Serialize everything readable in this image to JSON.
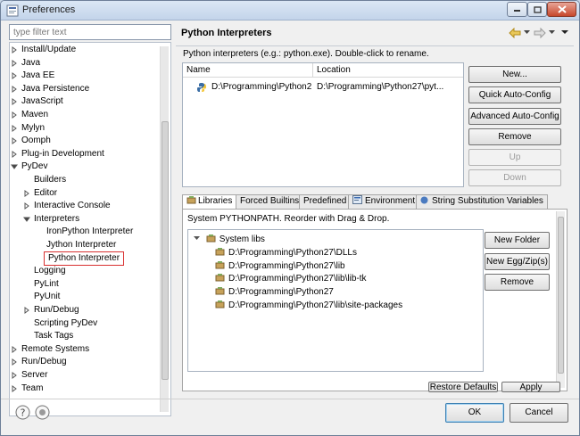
{
  "window": {
    "title": "Preferences"
  },
  "filter": {
    "placeholder": "type filter text"
  },
  "tree": [
    {
      "label": "Install/Update",
      "level": 0,
      "arrow": "right"
    },
    {
      "label": "Java",
      "level": 0,
      "arrow": "right"
    },
    {
      "label": "Java EE",
      "level": 0,
      "arrow": "right"
    },
    {
      "label": "Java Persistence",
      "level": 0,
      "arrow": "right"
    },
    {
      "label": "JavaScript",
      "level": 0,
      "arrow": "right"
    },
    {
      "label": "Maven",
      "level": 0,
      "arrow": "right"
    },
    {
      "label": "Mylyn",
      "level": 0,
      "arrow": "right"
    },
    {
      "label": "Oomph",
      "level": 0,
      "arrow": "right"
    },
    {
      "label": "Plug-in Development",
      "level": 0,
      "arrow": "right"
    },
    {
      "label": "PyDev",
      "level": 0,
      "arrow": "down"
    },
    {
      "label": "Builders",
      "level": 1,
      "arrow": "none"
    },
    {
      "label": "Editor",
      "level": 1,
      "arrow": "right"
    },
    {
      "label": "Interactive Console",
      "level": 1,
      "arrow": "right"
    },
    {
      "label": "Interpreters",
      "level": 1,
      "arrow": "down"
    },
    {
      "label": "IronPython Interpreter",
      "level": 2,
      "arrow": "none"
    },
    {
      "label": "Jython Interpreter",
      "level": 2,
      "arrow": "none"
    },
    {
      "label": "Python Interpreter",
      "level": 2,
      "arrow": "none",
      "selected": true
    },
    {
      "label": "Logging",
      "level": 1,
      "arrow": "none"
    },
    {
      "label": "PyLint",
      "level": 1,
      "arrow": "none"
    },
    {
      "label": "PyUnit",
      "level": 1,
      "arrow": "none"
    },
    {
      "label": "Run/Debug",
      "level": 1,
      "arrow": "right"
    },
    {
      "label": "Scripting PyDev",
      "level": 1,
      "arrow": "none"
    },
    {
      "label": "Task Tags",
      "level": 1,
      "arrow": "none"
    },
    {
      "label": "Remote Systems",
      "level": 0,
      "arrow": "right"
    },
    {
      "label": "Run/Debug",
      "level": 0,
      "arrow": "right"
    },
    {
      "label": "Server",
      "level": 0,
      "arrow": "right"
    },
    {
      "label": "Team",
      "level": 0,
      "arrow": "right"
    }
  ],
  "page": {
    "title": "Python Interpreters",
    "description": "Python interpreters (e.g.: python.exe).   Double-click to rename."
  },
  "table": {
    "columns": [
      "Name",
      "Location"
    ],
    "rows": [
      {
        "name": "D:\\Programming\\Python27\\",
        "location": "D:\\Programming\\Python27\\pyt..."
      }
    ]
  },
  "buttons": {
    "new": "New...",
    "quick_auto_config": "Quick Auto-Config",
    "advanced_auto_config": "Advanced Auto-Config",
    "remove": "Remove",
    "up": "Up",
    "down": "Down",
    "new_folder": "New Folder",
    "new_egg": "New Egg/Zip(s)",
    "remove_lib": "Remove",
    "restore_defaults": "Restore Defaults",
    "apply": "Apply",
    "ok": "OK",
    "cancel": "Cancel"
  },
  "tabs": [
    "Libraries",
    "Forced Builtins",
    "Predefined",
    "Environment",
    "String Substitution Variables"
  ],
  "libraries": {
    "hint": "System PYTHONPATH.   Reorder with Drag & Drop.",
    "root": "System libs",
    "items": [
      "D:\\Programming\\Python27\\DLLs",
      "D:\\Programming\\Python27\\lib",
      "D:\\Programming\\Python27\\lib\\lib-tk",
      "D:\\Programming\\Python27",
      "D:\\Programming\\Python27\\lib\\site-packages"
    ]
  }
}
